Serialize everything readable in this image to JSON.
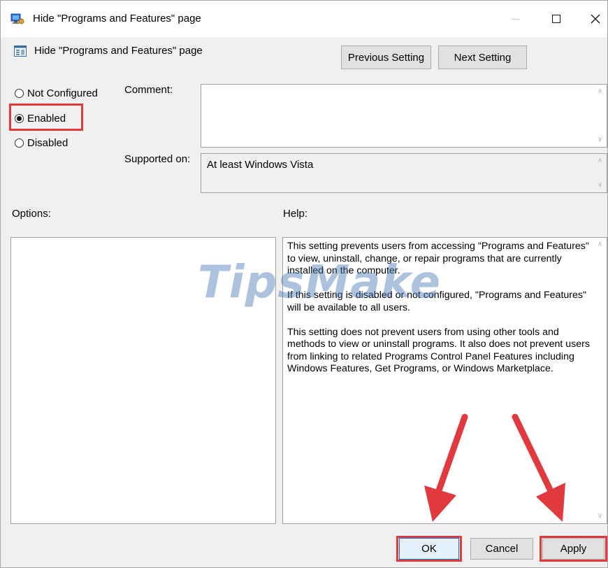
{
  "window": {
    "title": "Hide \"Programs and Features\" page",
    "minimize_glyph": "—",
    "close_glyph": "✕"
  },
  "header": {
    "setting_name": "Hide \"Programs and Features\" page",
    "previous_label": "Previous Setting",
    "next_label": "Next Setting"
  },
  "state": {
    "options": [
      {
        "label": "Not Configured",
        "checked": false
      },
      {
        "label": "Enabled",
        "checked": true
      },
      {
        "label": "Disabled",
        "checked": false
      }
    ]
  },
  "comment": {
    "label": "Comment:",
    "value": ""
  },
  "supported": {
    "label": "Supported on:",
    "value": "At least Windows Vista"
  },
  "options_panel": {
    "label": "Options:"
  },
  "help_panel": {
    "label": "Help:",
    "paragraphs": [
      "This setting prevents users from accessing \"Programs and Features\" to view, uninstall, change, or repair programs that are currently installed on the computer.",
      "If this setting is disabled or not configured, \"Programs and Features\" will be available to all users.",
      "This setting does not prevent users from using other tools and methods to view or uninstall programs.  It also does not prevent users from linking to related Programs Control Panel Features including Windows Features, Get Programs, or Windows Marketplace."
    ]
  },
  "footer": {
    "ok_label": "OK",
    "cancel_label": "Cancel",
    "apply_label": "Apply"
  },
  "watermark": {
    "text": "TipsMake"
  },
  "icons": {
    "title": "group-policy-setting-icon",
    "subheader": "policy-setting-icon",
    "scroll_up": "scroll-up-arrow-icon",
    "scroll_down": "scroll-down-arrow-icon"
  },
  "colors": {
    "highlight": "#e0393e",
    "window_bg": "#f0f0f0",
    "button_bg": "#e1e1e1",
    "default_button_border": "#0078d7",
    "watermark": "#4678b4"
  }
}
